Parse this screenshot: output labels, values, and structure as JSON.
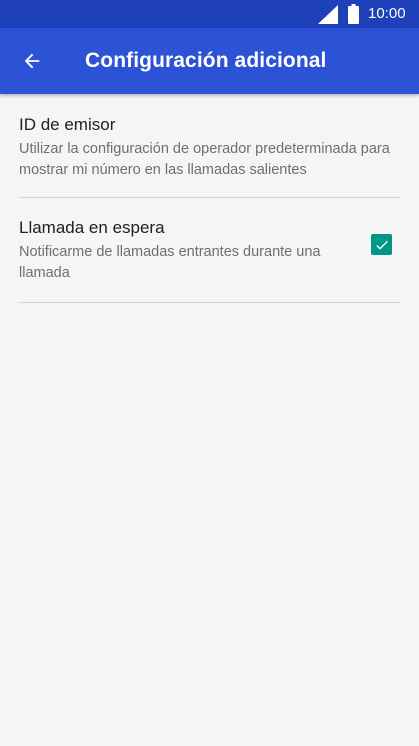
{
  "status_bar": {
    "time": "10:00",
    "signal_icon": "cell-signal-icon",
    "battery_icon": "battery-icon"
  },
  "app_bar": {
    "title": "Configuración adicional",
    "back_icon": "arrow-back-icon"
  },
  "settings": [
    {
      "title": "ID de emisor",
      "summary": "Utilizar la configuración de operador predeterminada para mostrar mi número en las llamadas salientes"
    },
    {
      "title": "Llamada en espera",
      "summary": "Notificarme de llamadas entrantes durante una llamada",
      "checked": true
    }
  ],
  "colors": {
    "status_bar": "#1e40b8",
    "app_bar": "#2c52d6",
    "background": "#f5f5f5",
    "accent": "#009688"
  }
}
